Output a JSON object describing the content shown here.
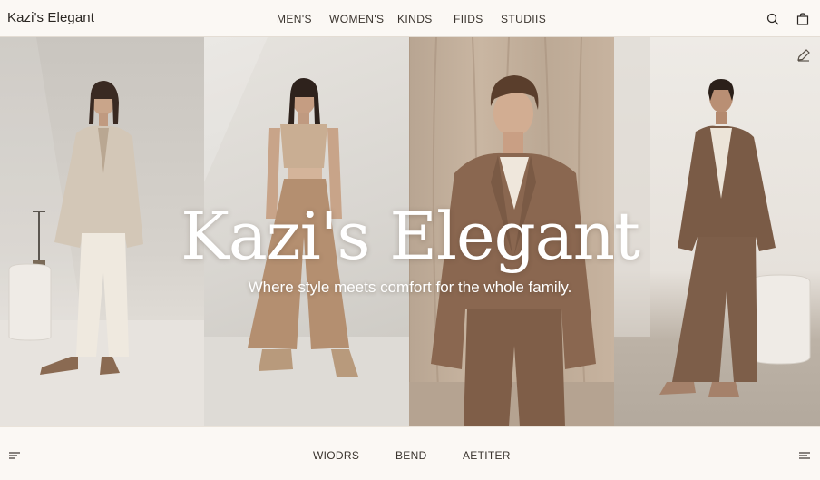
{
  "brand": {
    "name": "Kazi's Elegant"
  },
  "nav": {
    "items": [
      {
        "label": "MEN'S"
      },
      {
        "label": "WOMEN'S"
      },
      {
        "label": "KINDS"
      },
      {
        "label": "FIIDS"
      },
      {
        "label": "STUDIIS"
      }
    ]
  },
  "header_icons": {
    "search": "search-icon",
    "bag": "shopping-bag-icon"
  },
  "hero": {
    "title": "Kazi's Elegant",
    "subtitle": "Where style meets comfort for the whole family.",
    "edit_icon": "edit-icon"
  },
  "footer": {
    "items": [
      {
        "label": "WIODRS"
      },
      {
        "label": "BEND"
      },
      {
        "label": "AETITER"
      }
    ],
    "left_icon": "menu-icon",
    "right_icon": "menu-icon"
  },
  "colors": {
    "background": "#fbf8f4",
    "text": "#2a2622",
    "accent": "#a68d77"
  }
}
